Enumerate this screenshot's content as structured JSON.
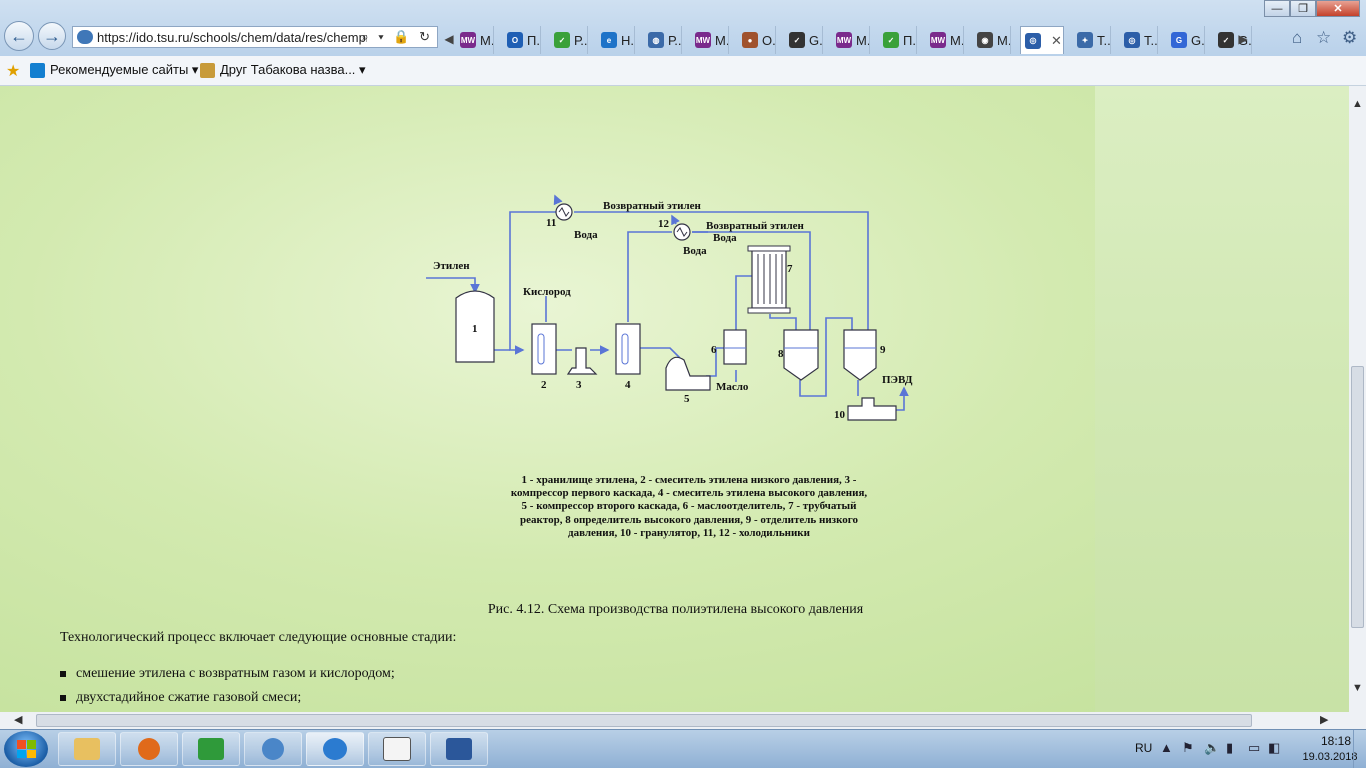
{
  "browser": {
    "url": "https://ido.tsu.ru/schools/chem/data/res/chemprc",
    "address_tools": "⌕ ▾ 🔒 ↻",
    "tabs": [
      {
        "label": "M...",
        "icon_color": "#7a2a8c",
        "icon_text": "MW"
      },
      {
        "label": "П...",
        "icon_color": "#1f5fb4",
        "icon_text": "O"
      },
      {
        "label": "Р...",
        "icon_color": "#3aa13a",
        "icon_text": "✓"
      },
      {
        "label": "Н...",
        "icon_color": "#1e73c8",
        "icon_text": "e"
      },
      {
        "label": "Р...",
        "icon_color": "#3b6aa8",
        "icon_text": "◍"
      },
      {
        "label": "M...",
        "icon_color": "#7a2a8c",
        "icon_text": "MW"
      },
      {
        "label": "О...",
        "icon_color": "#a0522d",
        "icon_text": "●"
      },
      {
        "label": "G...",
        "icon_color": "#333333",
        "icon_text": "✓"
      },
      {
        "label": "M...",
        "icon_color": "#7a2a8c",
        "icon_text": "MW"
      },
      {
        "label": "П...",
        "icon_color": "#3aa13a",
        "icon_text": "✓"
      },
      {
        "label": "M...",
        "icon_color": "#7a2a8c",
        "icon_text": "MW"
      },
      {
        "label": "M...",
        "icon_color": "#444444",
        "icon_text": "◉"
      },
      {
        "label": "",
        "icon_color": "#2c5ea8",
        "icon_text": "◎",
        "active": true
      },
      {
        "label": "T...",
        "icon_color": "#3b6aa8",
        "icon_text": "✦"
      },
      {
        "label": "T...",
        "icon_color": "#2c5ea8",
        "icon_text": "◎"
      },
      {
        "label": "G...",
        "icon_color": "#3367d6",
        "icon_text": "G"
      },
      {
        "label": "G...",
        "icon_color": "#333333",
        "icon_text": "✓"
      }
    ],
    "close_tab": "✕",
    "window_controls": {
      "minimize": "—",
      "maximize": "❐",
      "close": "✕"
    }
  },
  "favorites": {
    "recommended": "Рекомендуемые сайты ▾",
    "friend": "Друг Табакова назва... ▾"
  },
  "diagram": {
    "labels": {
      "ethylene": "Этилен",
      "oxygen": "Кислород",
      "return_ethylene_1": "Возвратный этилен",
      "return_ethylene_2": "Возвратный этилен",
      "water_11": "Вода",
      "water_12a": "Вода",
      "water_12b": "Вода",
      "oil": "Масло",
      "ldpe": "ПЭВД"
    },
    "numbers": [
      "1",
      "2",
      "3",
      "4",
      "5",
      "6",
      "7",
      "8",
      "9",
      "10",
      "11",
      "12"
    ]
  },
  "legend": [
    "1 - хранилище этилена, 2 - смеситель этилена низкого давления, 3 -",
    "компрессор первого каскада, 4 - смеситель этилена высокого давления,",
    "5 - компрессор второго каскада, 6 - маслоотделитель, 7 - трубчатый",
    "реактор, 8 определитель высокого давления, 9 - отделитель низкого",
    "давления, 10 - гранулятор, 11, 12 - холодильники"
  ],
  "caption": "Рис. 4.12. Схема производства полиэтилена высокого давления",
  "intro": "Технологический процесс включает следующие основные стадии:",
  "bullets": [
    "смешение этилена с возвратным газом и кислородом;",
    "двухстадийное сжатие газовой смеси;"
  ],
  "taskbar": {
    "lang": "RU",
    "time": "18:18",
    "date": "19.03.2018"
  }
}
